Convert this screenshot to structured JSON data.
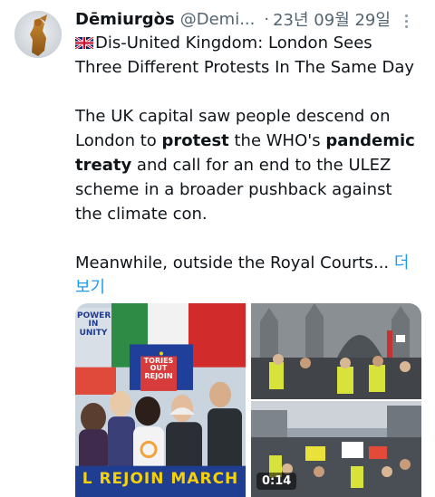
{
  "tweet": {
    "display_name": "Dēmiurgòs",
    "handle": "@Demi...",
    "separator": "·",
    "date": "23년 09월 29일",
    "headline_line1": "Dis-United Kingdom: London Sees",
    "headline_line2": "Three Different Protests In The Same Day",
    "para2_line1": "The UK capital saw people descend on",
    "para2_line2_a": "London to ",
    "para2_line2_bold1": "protest",
    "para2_line2_b": " the WHO's ",
    "para2_line2_bold2": "pandemic",
    "para2_line3_bold": "treaty",
    "para2_line3_rest": " and call for an end to the ULEZ",
    "para2_line4": "scheme in a broader pushback against",
    "para2_line5": "the climate con.",
    "para3_text": "Meanwhile, outside the Royal Courts... ",
    "show_more_part1": "더",
    "show_more_part2": "보기"
  },
  "icons": {
    "flag": "uk-flag-icon",
    "more": "more-options-icon"
  },
  "media": {
    "image1_sign_left": "POWER IN UNITY",
    "image1_sign_middle": "TORIES OUT REJOIN",
    "image1_banner": "L REJOIN MARCH",
    "image3_duration": "0:14"
  },
  "colors": {
    "text": "#0f1419",
    "secondary": "#536471",
    "link": "#1d9bf0"
  }
}
